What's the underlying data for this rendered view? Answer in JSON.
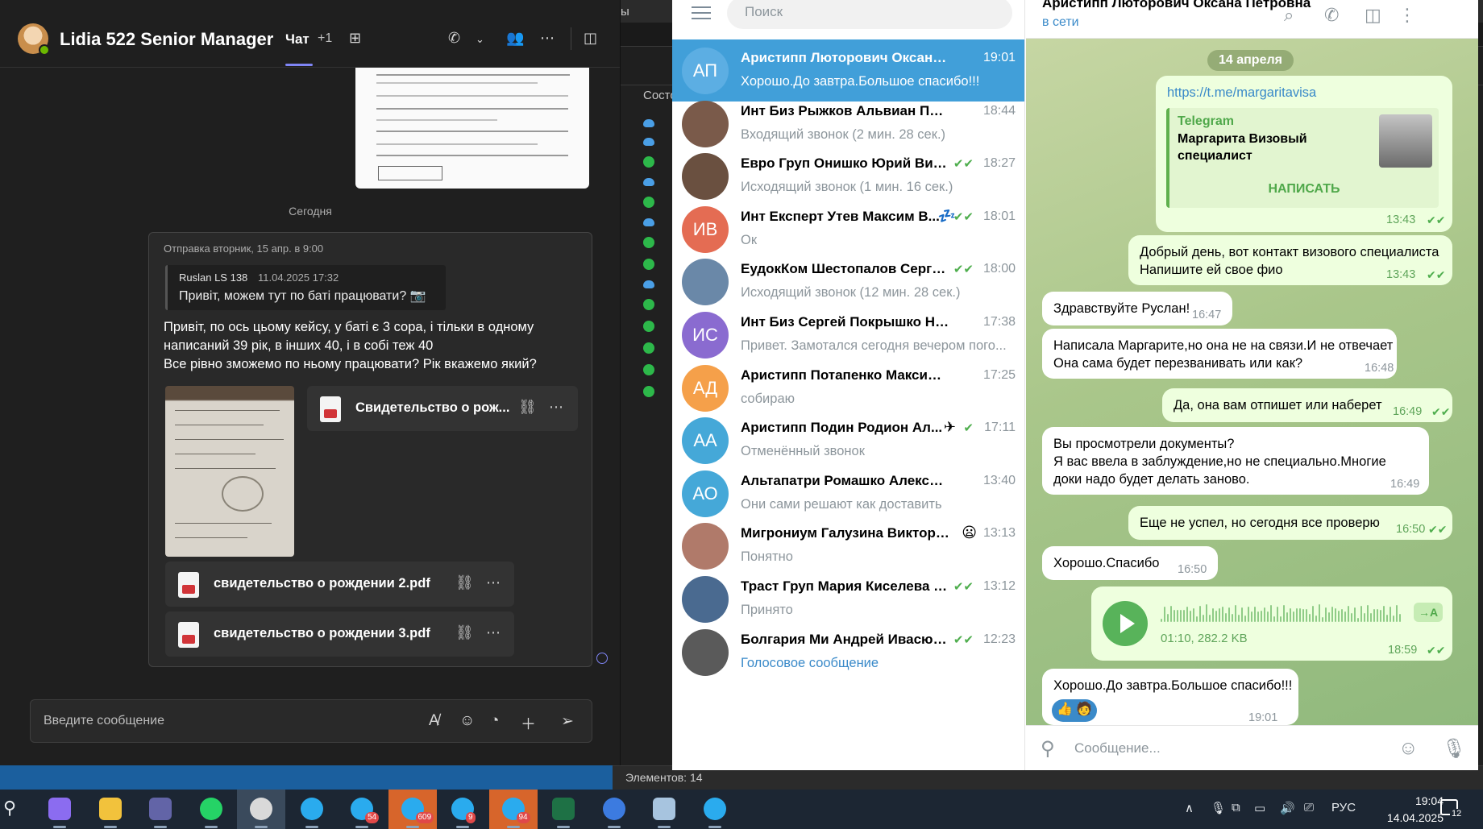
{
  "explorer": {
    "fragment": "ы",
    "column_header": "Состо",
    "status_bar": "Элементов: 14"
  },
  "teams": {
    "title": "Lidia 522 Senior Manager",
    "tab_chat": "Чат",
    "tab_more": "+1",
    "date_separator": "Сегодня",
    "message": {
      "meta": "Отправка вторник, 15 апр. в 9:00",
      "quote_author": "Ruslan LS 138",
      "quote_date": "11.04.2025 17:32",
      "quote_text": "Привіт, можем тут по баті працювати? 📷",
      "text": "Привіт, по ось цьому кейсу, у баті є 3 сора, і тільки в одному\nнаписаний 39 рік, в інших 40, і в собі теж 40\nВсе рівно зможемо по ньому працювати? Рік вкажемо який?",
      "files": [
        "Свидетельство о рож...",
        "свидетельство о рождении 2.pdf",
        "свидетельство о рождении 3.pdf"
      ]
    },
    "composer_placeholder": "Введите сообщение"
  },
  "telegram": {
    "search_placeholder": "Поиск",
    "chats": [
      {
        "initials": "АП",
        "color": "#5caee3",
        "name": "Аристипп Люторович Оксана Петр...",
        "time": "19:01",
        "preview": "Хорошо.До завтра.Большое спасибо!!!",
        "active": true
      },
      {
        "initials": "",
        "color": "#7a5a4a",
        "name": "Инт Биз Рыжков Альвиан Петрович",
        "time": "18:44",
        "preview": "Входящий звонок (2 мин. 28 сек.)"
      },
      {
        "initials": "",
        "color": "#6a5040",
        "name": "Евро Груп Онишко Юрий Викт...",
        "time": "18:27",
        "preview": "Исходящий звонок (1 мин. 16 сек.)",
        "check": "✔✔"
      },
      {
        "initials": "ИВ",
        "color": "#e46c53",
        "name": "Инт Експерт Утев Максим В...",
        "time": "18:01",
        "preview": "Ок",
        "check": "✔✔",
        "emoji": "💤"
      },
      {
        "initials": "",
        "color": "#6a88a8",
        "name": "ЕудокКом Шестопалов Сергей ...",
        "time": "18:00",
        "preview": "Исходящий звонок (12 мин. 28 сек.)",
        "check": "✔✔"
      },
      {
        "initials": "ИС",
        "color": "#8a6bd0",
        "name": "Инт Биз Сергей Покрышко Никита...",
        "time": "17:38",
        "preview": "Привет. Замотался сегодня вечером пого..."
      },
      {
        "initials": "АД",
        "color": "#f5a04a",
        "name": "Аристипп Потапенко Максим Ден...",
        "time": "17:25",
        "preview": "собираю"
      },
      {
        "initials": "АА",
        "color": "#45a8d8",
        "name": "Аристипп Подин Родион Ал...",
        "time": "17:11",
        "preview": "Отменённый звонок",
        "check": "✔",
        "emoji": "✈"
      },
      {
        "initials": "АО",
        "color": "#45a8d8",
        "name": "Альтапатри Ромашко Александр О...",
        "time": "13:40",
        "preview": "Они сами решают как доставить"
      },
      {
        "initials": "",
        "color": "#b07a6a",
        "name": "Мигрониум Галузина Виктори...",
        "time": "13:13",
        "preview": "Понятно",
        "emoji": "😦"
      },
      {
        "initials": "",
        "color": "#4a6a90",
        "name": "Траст Груп Мария Киселева рек...",
        "time": "13:12",
        "preview": "Принято",
        "check": "✔✔"
      },
      {
        "initials": "",
        "color": "#5a5a5a",
        "name": "Болгария Ми Андрей Ивасюк (...",
        "time": "12:23",
        "preview": "Голосовое сообщение",
        "check": "✔✔",
        "preview_blue": true
      }
    ],
    "header_name": "Аристипп Люторович Оксана Петровна",
    "header_status": "в сети",
    "date_pill": "14 апреля",
    "messages": {
      "m1_link": "https://t.me/margaritavisa",
      "m1_site": "Telegram",
      "m1_title": "Маргарита Визовый специалист",
      "m1_button": "НАПИСАТЬ",
      "m1_time": "13:43",
      "m2_text": "Добрый день, вот контакт визового специалиста\nНапишите ей свое фио",
      "m2_time": "13:43",
      "m3_text": "Здравствуйте Руслан!",
      "m3_time": "16:47",
      "m4_text": "Написала Маргарите,но она не на связи.И не отвечает\nОна сама будет перезванивать или как?",
      "m4_time": "16:48",
      "m5_text": "Да, она вам отпишет или наберет",
      "m5_time": "16:49",
      "m6_text": "Вы просмотрели документы?\nЯ вас ввела в заблуждение,но не специально.Многие\nдоки надо будет делать заново.",
      "m6_time": "16:49",
      "m7_text": "Еще не успел, но сегодня все проверю",
      "m7_time": "16:50",
      "m8_text": "Хорошо.Спасибо",
      "m8_time": "16:50",
      "voice_meta": "01:10, 282.2 KB",
      "voice_stt": "→A",
      "voice_time": "18:59",
      "m10_text": "Хорошо.До завтра.Большое спасибо!!!",
      "m10_time": "19:01"
    },
    "composer_placeholder": "Сообщение..."
  },
  "taskbar": {
    "apps": [
      {
        "name": "copilot",
        "color": "#8b6cf0"
      },
      {
        "name": "file-explorer",
        "color": "#f2c23c"
      },
      {
        "name": "teams",
        "color": "#6264a7"
      },
      {
        "name": "whatsapp",
        "color": "#25d366",
        "round": true
      },
      {
        "name": "chrome",
        "color": "#d9d9d9",
        "round": true,
        "hl2": true
      },
      {
        "name": "telegram",
        "color": "#2aabee",
        "round": true
      },
      {
        "name": "telegram-2",
        "color": "#2aabee",
        "round": true,
        "badge": "54"
      },
      {
        "name": "telegram-3",
        "color": "#2aabee",
        "round": true,
        "badge": "609",
        "hl": true
      },
      {
        "name": "telegram-4",
        "color": "#2aabee",
        "round": true,
        "badge": "9"
      },
      {
        "name": "telegram-5",
        "color": "#2aabee",
        "round": true,
        "badge": "94",
        "hl": true
      },
      {
        "name": "excel",
        "color": "#1e7145"
      },
      {
        "name": "browser",
        "color": "#3c7be0",
        "round": true
      },
      {
        "name": "notes",
        "color": "#a7c4df"
      },
      {
        "name": "phone",
        "color": "#2aabee",
        "round": true
      }
    ],
    "language": "РУС",
    "time": "19:04",
    "date": "14.04.2025",
    "notifications": "12"
  }
}
